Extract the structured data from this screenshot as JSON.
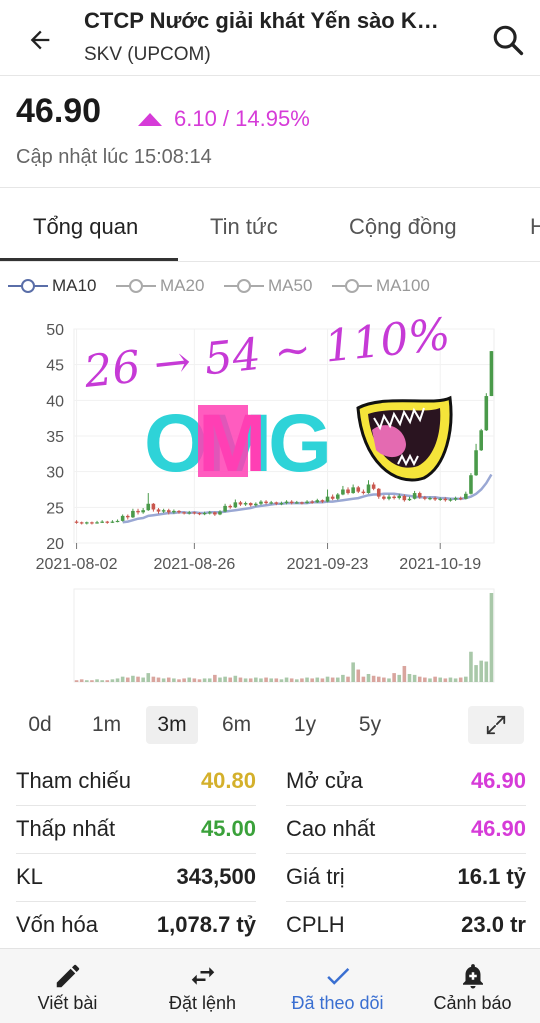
{
  "header": {
    "title": "CTCP Nước giải khát Yến sào Khánh Hòa",
    "subtitle": "SKV (UPCOM)"
  },
  "quote": {
    "price": "46.90",
    "change": "6.10 / 14.95%",
    "updated": "Cập nhật lúc 15:08:14",
    "change_color": "#d63bd8"
  },
  "tabs": [
    {
      "label": "Tổng quan",
      "active": true
    },
    {
      "label": "Tin tức"
    },
    {
      "label": "Cộng đồng"
    },
    {
      "label": "H"
    }
  ],
  "ma_legend": [
    {
      "label": "MA10",
      "selected": true
    },
    {
      "label": "MA20"
    },
    {
      "label": "MA50"
    },
    {
      "label": "MA100"
    }
  ],
  "overlay": {
    "handwriting": "26 → 54 ~ 110%",
    "sticker": "OMG"
  },
  "chart_data": {
    "type": "candlestick",
    "y_ticks": [
      "50",
      "45",
      "40",
      "35",
      "30",
      "25",
      "20"
    ],
    "ylim": [
      20,
      50
    ],
    "x_ticks": [
      "2021-08-02",
      "2021-08-26",
      "2021-09-23",
      "2021-10-19"
    ],
    "colors": {
      "up": "#4a9a4a",
      "down": "#c9574e",
      "ma": "#9aa8d4",
      "vol_up": "#a9c8a9",
      "vol_down": "#d9a59e"
    },
    "candles": [
      {
        "o": 23.0,
        "c": 22.9,
        "h": 23.2,
        "l": 22.7,
        "v": 0.02
      },
      {
        "o": 22.9,
        "c": 22.8,
        "h": 23.0,
        "l": 22.6,
        "v": 0.03
      },
      {
        "o": 22.8,
        "c": 22.9,
        "h": 23.0,
        "l": 22.6,
        "v": 0.02
      },
      {
        "o": 22.9,
        "c": 22.8,
        "h": 23.0,
        "l": 22.6,
        "v": 0.02
      },
      {
        "o": 22.8,
        "c": 22.9,
        "h": 23.1,
        "l": 22.7,
        "v": 0.03
      },
      {
        "o": 22.9,
        "c": 23.0,
        "h": 23.2,
        "l": 22.8,
        "v": 0.02
      },
      {
        "o": 23.0,
        "c": 22.9,
        "h": 23.1,
        "l": 22.7,
        "v": 0.02
      },
      {
        "o": 22.9,
        "c": 23.0,
        "h": 23.2,
        "l": 22.8,
        "v": 0.03
      },
      {
        "o": 23.0,
        "c": 23.1,
        "h": 23.3,
        "l": 22.9,
        "v": 0.04
      },
      {
        "o": 23.1,
        "c": 23.8,
        "h": 24.0,
        "l": 23.0,
        "v": 0.06
      },
      {
        "o": 23.8,
        "c": 23.6,
        "h": 24.0,
        "l": 23.3,
        "v": 0.05
      },
      {
        "o": 23.6,
        "c": 24.5,
        "h": 24.8,
        "l": 23.5,
        "v": 0.07
      },
      {
        "o": 24.5,
        "c": 24.3,
        "h": 24.8,
        "l": 24.0,
        "v": 0.06
      },
      {
        "o": 24.3,
        "c": 24.6,
        "h": 24.9,
        "l": 24.1,
        "v": 0.05
      },
      {
        "o": 24.6,
        "c": 25.5,
        "h": 27.0,
        "l": 24.5,
        "v": 0.1
      },
      {
        "o": 25.5,
        "c": 24.7,
        "h": 25.6,
        "l": 24.4,
        "v": 0.06
      },
      {
        "o": 24.7,
        "c": 24.4,
        "h": 24.9,
        "l": 24.1,
        "v": 0.05
      },
      {
        "o": 24.4,
        "c": 24.6,
        "h": 24.8,
        "l": 24.2,
        "v": 0.04
      },
      {
        "o": 24.6,
        "c": 24.3,
        "h": 24.8,
        "l": 24.0,
        "v": 0.05
      },
      {
        "o": 24.3,
        "c": 24.5,
        "h": 24.7,
        "l": 24.1,
        "v": 0.04
      },
      {
        "o": 24.5,
        "c": 24.3,
        "h": 24.6,
        "l": 24.1,
        "v": 0.03
      },
      {
        "o": 24.3,
        "c": 24.2,
        "h": 24.4,
        "l": 24.0,
        "v": 0.04
      },
      {
        "o": 24.2,
        "c": 24.3,
        "h": 24.5,
        "l": 24.0,
        "v": 0.05
      },
      {
        "o": 24.3,
        "c": 24.2,
        "h": 24.4,
        "l": 24.0,
        "v": 0.04
      },
      {
        "o": 24.2,
        "c": 24.1,
        "h": 24.3,
        "l": 23.9,
        "v": 0.03
      },
      {
        "o": 24.1,
        "c": 24.2,
        "h": 24.4,
        "l": 23.9,
        "v": 0.04
      },
      {
        "o": 24.2,
        "c": 24.3,
        "h": 24.5,
        "l": 24.0,
        "v": 0.04
      },
      {
        "o": 24.3,
        "c": 24.0,
        "h": 24.4,
        "l": 23.8,
        "v": 0.08
      },
      {
        "o": 24.0,
        "c": 24.4,
        "h": 24.6,
        "l": 23.9,
        "v": 0.05
      },
      {
        "o": 24.4,
        "c": 25.2,
        "h": 25.5,
        "l": 24.3,
        "v": 0.06
      },
      {
        "o": 25.2,
        "c": 25.0,
        "h": 25.4,
        "l": 24.8,
        "v": 0.05
      },
      {
        "o": 25.0,
        "c": 25.7,
        "h": 26.1,
        "l": 24.9,
        "v": 0.07
      },
      {
        "o": 25.7,
        "c": 25.4,
        "h": 25.9,
        "l": 25.2,
        "v": 0.05
      },
      {
        "o": 25.4,
        "c": 25.6,
        "h": 25.8,
        "l": 25.2,
        "v": 0.04
      },
      {
        "o": 25.6,
        "c": 25.3,
        "h": 25.7,
        "l": 25.1,
        "v": 0.04
      },
      {
        "o": 25.3,
        "c": 25.5,
        "h": 25.7,
        "l": 25.1,
        "v": 0.05
      },
      {
        "o": 25.5,
        "c": 25.8,
        "h": 26.0,
        "l": 25.3,
        "v": 0.04
      },
      {
        "o": 25.8,
        "c": 25.6,
        "h": 26.0,
        "l": 25.4,
        "v": 0.05
      },
      {
        "o": 25.6,
        "c": 25.7,
        "h": 25.9,
        "l": 25.4,
        "v": 0.04
      },
      {
        "o": 25.7,
        "c": 25.5,
        "h": 25.8,
        "l": 25.3,
        "v": 0.04
      },
      {
        "o": 25.5,
        "c": 25.6,
        "h": 25.8,
        "l": 25.3,
        "v": 0.03
      },
      {
        "o": 25.6,
        "c": 25.8,
        "h": 26.0,
        "l": 25.4,
        "v": 0.05
      },
      {
        "o": 25.8,
        "c": 25.6,
        "h": 26.0,
        "l": 25.4,
        "v": 0.04
      },
      {
        "o": 25.6,
        "c": 25.7,
        "h": 25.9,
        "l": 25.5,
        "v": 0.03
      },
      {
        "o": 25.7,
        "c": 25.6,
        "h": 25.8,
        "l": 25.4,
        "v": 0.04
      },
      {
        "o": 25.6,
        "c": 25.8,
        "h": 26.0,
        "l": 25.5,
        "v": 0.05
      },
      {
        "o": 25.8,
        "c": 25.7,
        "h": 26.0,
        "l": 25.5,
        "v": 0.04
      },
      {
        "o": 25.7,
        "c": 26.0,
        "h": 26.2,
        "l": 25.6,
        "v": 0.05
      },
      {
        "o": 26.0,
        "c": 25.8,
        "h": 26.1,
        "l": 25.6,
        "v": 0.04
      },
      {
        "o": 25.8,
        "c": 26.5,
        "h": 27.5,
        "l": 25.7,
        "v": 0.06
      },
      {
        "o": 26.5,
        "c": 26.2,
        "h": 26.8,
        "l": 26.0,
        "v": 0.05
      },
      {
        "o": 26.2,
        "c": 26.8,
        "h": 27.0,
        "l": 26.0,
        "v": 0.05
      },
      {
        "o": 26.8,
        "c": 27.5,
        "h": 28.0,
        "l": 26.7,
        "v": 0.08
      },
      {
        "o": 27.5,
        "c": 27.0,
        "h": 27.8,
        "l": 26.8,
        "v": 0.06
      },
      {
        "o": 27.0,
        "c": 27.8,
        "h": 28.2,
        "l": 26.9,
        "v": 0.22
      },
      {
        "o": 27.8,
        "c": 27.2,
        "h": 28.0,
        "l": 27.0,
        "v": 0.14
      },
      {
        "o": 27.2,
        "c": 27.0,
        "h": 27.5,
        "l": 26.8,
        "v": 0.06
      },
      {
        "o": 27.0,
        "c": 28.2,
        "h": 28.8,
        "l": 26.9,
        "v": 0.09
      },
      {
        "o": 28.2,
        "c": 27.6,
        "h": 28.5,
        "l": 27.4,
        "v": 0.07
      },
      {
        "o": 27.6,
        "c": 26.5,
        "h": 27.7,
        "l": 26.2,
        "v": 0.06
      },
      {
        "o": 26.5,
        "c": 26.2,
        "h": 26.7,
        "l": 26.0,
        "v": 0.05
      },
      {
        "o": 26.2,
        "c": 26.5,
        "h": 26.8,
        "l": 26.0,
        "v": 0.04
      },
      {
        "o": 26.5,
        "c": 26.3,
        "h": 26.7,
        "l": 26.1,
        "v": 0.1
      },
      {
        "o": 26.3,
        "c": 26.6,
        "h": 26.9,
        "l": 26.1,
        "v": 0.08
      },
      {
        "o": 26.6,
        "c": 26.0,
        "h": 26.8,
        "l": 25.8,
        "v": 0.18
      },
      {
        "o": 26.0,
        "c": 26.2,
        "h": 26.5,
        "l": 25.9,
        "v": 0.09
      },
      {
        "o": 26.2,
        "c": 27.0,
        "h": 27.3,
        "l": 26.1,
        "v": 0.08
      },
      {
        "o": 27.0,
        "c": 26.4,
        "h": 27.2,
        "l": 26.2,
        "v": 0.06
      },
      {
        "o": 26.4,
        "c": 26.2,
        "h": 26.6,
        "l": 26.0,
        "v": 0.05
      },
      {
        "o": 26.2,
        "c": 26.3,
        "h": 26.5,
        "l": 26.0,
        "v": 0.04
      },
      {
        "o": 26.3,
        "c": 26.1,
        "h": 26.5,
        "l": 25.9,
        "v": 0.06
      },
      {
        "o": 26.1,
        "c": 26.2,
        "h": 26.4,
        "l": 25.9,
        "v": 0.05
      },
      {
        "o": 26.2,
        "c": 26.0,
        "h": 26.4,
        "l": 25.8,
        "v": 0.04
      },
      {
        "o": 26.0,
        "c": 26.1,
        "h": 26.3,
        "l": 25.8,
        "v": 0.05
      },
      {
        "o": 26.1,
        "c": 26.3,
        "h": 26.5,
        "l": 25.9,
        "v": 0.04
      },
      {
        "o": 26.3,
        "c": 26.2,
        "h": 26.5,
        "l": 26.0,
        "v": 0.05
      },
      {
        "o": 26.2,
        "c": 26.9,
        "h": 27.2,
        "l": 26.1,
        "v": 0.06
      },
      {
        "o": 26.9,
        "c": 29.5,
        "h": 29.8,
        "l": 26.8,
        "v": 0.34
      },
      {
        "o": 29.5,
        "c": 33.0,
        "h": 33.9,
        "l": 29.4,
        "v": 0.19
      },
      {
        "o": 33.0,
        "c": 35.8,
        "h": 36.0,
        "l": 32.9,
        "v": 0.24
      },
      {
        "o": 35.8,
        "c": 40.6,
        "h": 41.0,
        "l": 35.7,
        "v": 0.23
      },
      {
        "o": 40.6,
        "c": 46.9,
        "h": 46.9,
        "l": 40.6,
        "v": 1.0
      }
    ],
    "ma10": [
      null,
      null,
      null,
      null,
      null,
      null,
      null,
      null,
      null,
      22.9,
      23.0,
      23.2,
      23.4,
      23.5,
      23.8,
      23.9,
      24.0,
      24.1,
      24.2,
      24.2,
      24.3,
      24.3,
      24.2,
      24.3,
      24.2,
      24.2,
      24.3,
      24.3,
      24.3,
      24.4,
      24.5,
      24.6,
      24.7,
      24.8,
      24.9,
      25.1,
      25.2,
      25.3,
      25.4,
      25.5,
      25.5,
      25.6,
      25.6,
      25.6,
      25.6,
      25.6,
      25.7,
      25.7,
      25.7,
      25.8,
      25.8,
      25.9,
      26.0,
      26.1,
      26.2,
      26.3,
      26.5,
      26.7,
      26.8,
      26.8,
      26.9,
      26.9,
      26.9,
      26.8,
      26.7,
      26.6,
      26.5,
      26.4,
      26.4,
      26.4,
      26.4,
      26.3,
      26.3,
      26.2,
      26.2,
      26.2,
      26.3,
      26.5,
      26.9,
      27.5,
      28.4,
      29.6
    ]
  },
  "range_buttons": [
    {
      "label": "0d"
    },
    {
      "label": "1m"
    },
    {
      "label": "3m",
      "active": true
    },
    {
      "label": "6m"
    },
    {
      "label": "1y"
    },
    {
      "label": "5y"
    }
  ],
  "stats": {
    "ref": {
      "label": "Tham chiếu",
      "value": "40.80",
      "color": "#d4b02b"
    },
    "open": {
      "label": "Mở cửa",
      "value": "46.90",
      "color": "#d63bd8"
    },
    "low": {
      "label": "Thấp nhất",
      "value": "45.00",
      "color": "#3aa13a"
    },
    "high": {
      "label": "Cao nhất",
      "value": "46.90",
      "color": "#d63bd8"
    },
    "vol": {
      "label": "KL",
      "value": "343,500",
      "color": "#222222"
    },
    "val": {
      "label": "Giá trị",
      "value": "16.1 tỷ",
      "color": "#222222"
    },
    "cap": {
      "label": "Vốn hóa",
      "value": "1,078.7 tỷ",
      "color": "#222222"
    },
    "shares": {
      "label": "CPLH",
      "value": "23.0 tr",
      "color": "#222222"
    }
  },
  "bottom_nav": [
    {
      "label": "Viết bài",
      "icon": "pencil-icon"
    },
    {
      "label": "Đặt lệnh",
      "icon": "swap-arrows-icon"
    },
    {
      "label": "Đã theo dõi",
      "icon": "check-icon",
      "active": true
    },
    {
      "label": "Cảnh báo",
      "icon": "bell-plus-icon"
    }
  ]
}
